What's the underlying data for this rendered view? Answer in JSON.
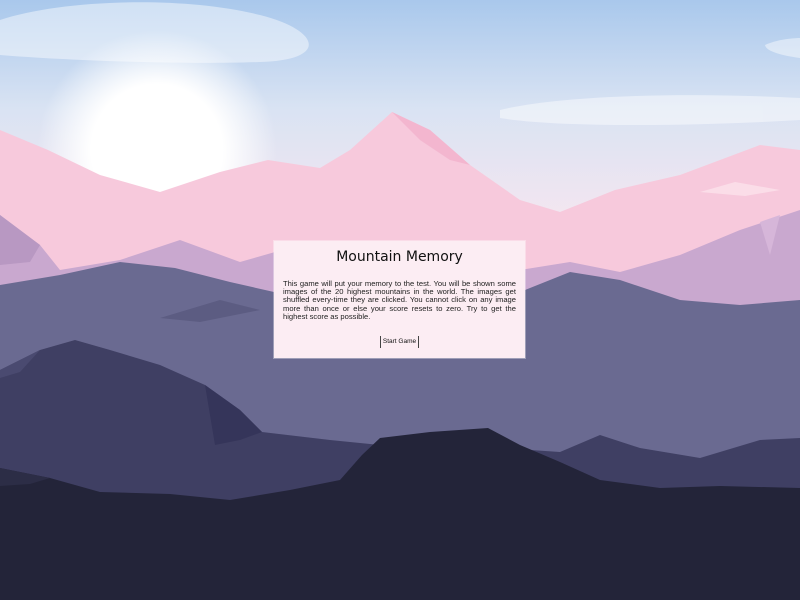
{
  "modal": {
    "title": "Mountain Memory",
    "description": "This game will put your memory to the test. You will be shown some images of the 20 highest mountains in the world. The images get shuffled every-time they are clicked. You cannot click on any image more than once or else your score resets to zero. Try to get the highest score as possible.",
    "start_label": "Start Game"
  },
  "colors": {
    "sky_top": "#a9c8ec",
    "sky_bottom": "#f6e6f0",
    "sun": "#ffffff",
    "pink_mountain": "#f7c9dc",
    "lavender_mountain": "#c9a8cf",
    "slate_mountain": "#6a6a91",
    "indigo_mountain": "#3f3f63",
    "night_ground": "#232439",
    "modal_bg": "#fcedf3"
  }
}
